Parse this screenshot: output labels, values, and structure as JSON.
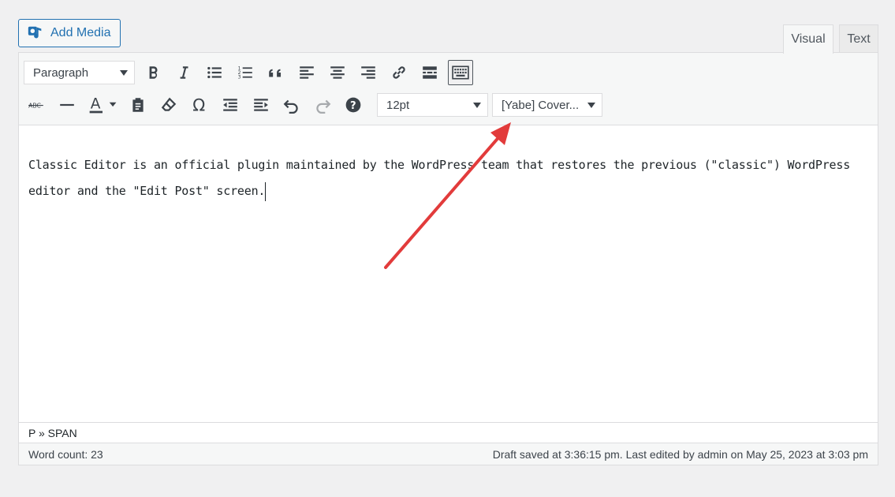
{
  "media": {
    "add_media_label": "Add Media"
  },
  "tabs": [
    {
      "label": "Visual"
    },
    {
      "label": "Text"
    }
  ],
  "toolbar": {
    "format_select": "Paragraph",
    "font_size_select": "12pt",
    "font_family_select": "[Yabe] Cover..."
  },
  "content": {
    "text": "Classic Editor is an official plugin maintained by the WordPress team that restores the previous (\"classic\") WordPress editor and the \"Edit Post\" screen."
  },
  "path": {
    "label": "P » SPAN"
  },
  "status": {
    "word_count": "Word count: 23",
    "saved": "Draft saved at 3:36:15 pm. Last edited by admin on May 25, 2023 at 3:03 pm"
  },
  "colors": {
    "accent": "#2271b1",
    "annotation_arrow": "#e23b3b"
  }
}
